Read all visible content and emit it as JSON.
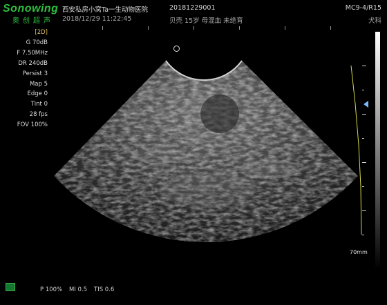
{
  "brand": {
    "name": "Sonowing",
    "subtitle": "奥创超声"
  },
  "header": {
    "clinic": "西安私房小窝Ta一生动物医院",
    "datetime": "2018/12/29 11:22:45",
    "patient_id": "20181229001",
    "patient_info": "贝壳 15岁 母混血 未绝育",
    "probe": "MC9-4/R15",
    "exam": "犬科"
  },
  "params": {
    "mode": "[2D]",
    "gain": "G 70dB",
    "freq": "F 7.50MHz",
    "dr": "DR 240dB",
    "persist": "Persist 3",
    "map": "Map 5",
    "edge": "Edge 0",
    "tint": "Tint 0",
    "fps": "28 fps",
    "fov": "FOV 100%"
  },
  "depth_label": "70mm",
  "footer": {
    "power": "P 100%",
    "mi": "MI 0.5",
    "tis": "TIS 0.6"
  },
  "colors": {
    "brand": "#2fbf3f",
    "mode": "#e0c060",
    "focus": "#7ab8ff",
    "tgc": "#d8d84a"
  },
  "icons": {
    "orientation": "orientation-marker-icon",
    "focus": "focus-triangle-icon",
    "probe": "probe-icon"
  }
}
